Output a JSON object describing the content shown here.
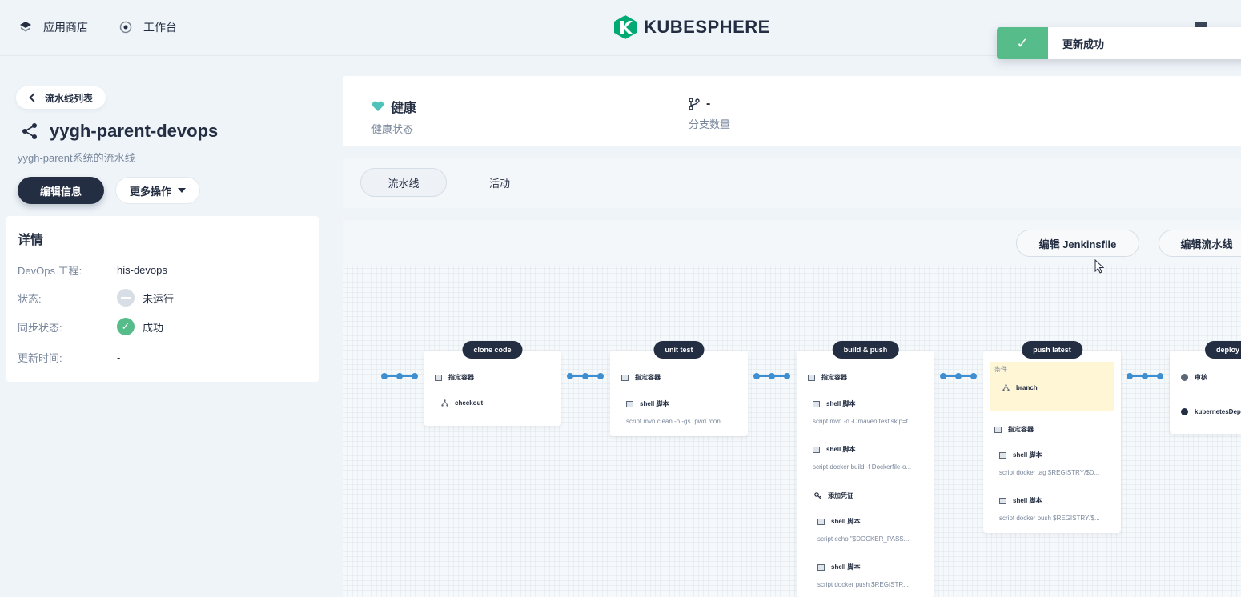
{
  "topbar": {
    "app_store": "应用商店",
    "workbench": "工作台",
    "logo_text": "KUBESPHERE"
  },
  "toast": {
    "message": "更新成功",
    "icon": "check-icon"
  },
  "sidebar": {
    "back_label": "流水线列表",
    "pipeline_name": "yygh-parent-devops",
    "description": "yygh-parent系统的流水线",
    "edit_info": "编辑信息",
    "more_actions": "更多操作",
    "details_title": "详情",
    "details": {
      "project_key": "DevOps 工程:",
      "project_val": "his-devops",
      "status_key": "状态:",
      "status_val": "未运行",
      "sync_key": "同步状态:",
      "sync_val": "成功",
      "updated_key": "更新时间:",
      "updated_val": "-"
    }
  },
  "summary": {
    "health_value": "健康",
    "health_label": "健康状态",
    "branch_value": "-",
    "branch_label": "分支数量"
  },
  "tabs": {
    "pipeline": "流水线",
    "activity": "活动"
  },
  "canvas": {
    "edit_jenkinsfile": "编辑 Jenkinsfile",
    "edit_pipeline": "编辑流水线"
  },
  "stages": {
    "clone": {
      "title": "clone code",
      "container": "指定容器",
      "checkout": "checkout"
    },
    "unit": {
      "title": "unit test",
      "container": "指定容器",
      "shell": "shell 脚本",
      "script": "script   mvn clean -o -gs `pwd`/con"
    },
    "build": {
      "title": "build & push",
      "container": "指定容器",
      "shell1": "shell 脚本",
      "script1": "script   mvn -o -Dmaven test skip=t",
      "shell2": "shell 脚本",
      "script2": "script   docker build -f Dockerfile-o...",
      "cred": "添加凭证",
      "shell3": "shell 脚本",
      "script3": "script   echo \"$DOCKER_PASS...",
      "shell4": "shell 脚本",
      "script4": "script   docker push $REGISTR..."
    },
    "latest": {
      "title": "push latest",
      "cond": "条件",
      "branch": "branch",
      "container": "指定容器",
      "shell1": "shell 脚本",
      "script1": "script   docker tag $REGISTRY/$D...",
      "shell2": "shell 脚本",
      "script2": "script   docker push $REGISTRY/$..."
    },
    "deploy": {
      "title": "deploy t",
      "review": "审核",
      "k8s": "kubernetesDep"
    }
  },
  "colors": {
    "dark": "#242e42",
    "success": "#55bc8a",
    "link": "#3d8fd1",
    "bg": "#eff4f9"
  }
}
